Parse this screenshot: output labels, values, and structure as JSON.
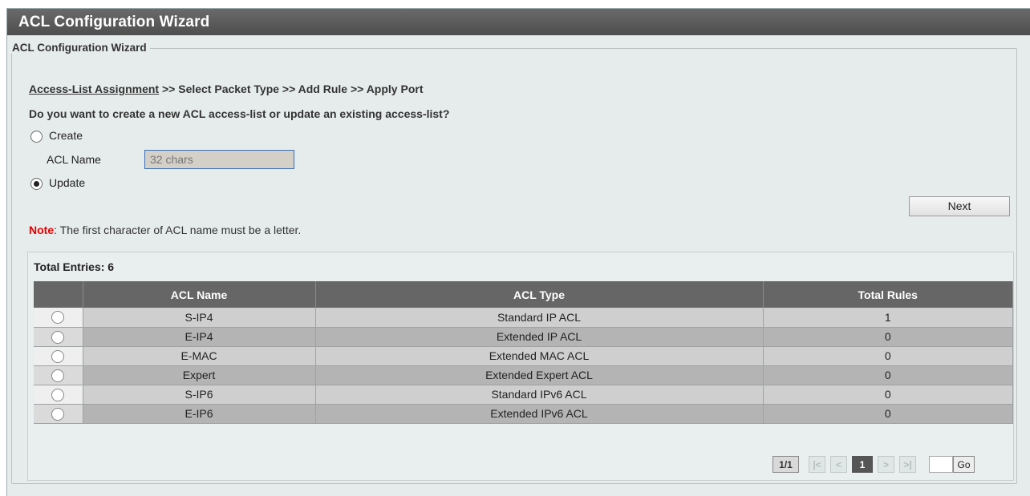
{
  "window": {
    "title": "ACL Configuration Wizard"
  },
  "panel": {
    "legend": "ACL Configuration Wizard"
  },
  "breadcrumb": {
    "current": "Access-List Assignment",
    "rest": " >> Select Packet Type >> Add Rule >> Apply Port"
  },
  "question": "Do you want to create a new ACL access-list or update an existing access-list?",
  "options": {
    "create_label": "Create",
    "update_label": "Update",
    "selected": "Update"
  },
  "acl_name": {
    "label": "ACL Name",
    "placeholder": "32 chars",
    "value": ""
  },
  "next_button": "Next",
  "note": {
    "prefix": "Note",
    "text": ":  The first character of ACL name must be a letter."
  },
  "table": {
    "total_label": "Total Entries: 6",
    "columns": [
      "",
      "ACL Name",
      "ACL Type",
      "Total Rules"
    ],
    "rows": [
      {
        "name": "S-IP4",
        "type": "Standard IP ACL",
        "rules": "1"
      },
      {
        "name": "E-IP4",
        "type": "Extended IP ACL",
        "rules": "0"
      },
      {
        "name": "E-MAC",
        "type": "Extended MAC ACL",
        "rules": "0"
      },
      {
        "name": "Expert",
        "type": "Extended Expert ACL",
        "rules": "0"
      },
      {
        "name": "S-IP6",
        "type": "Standard IPv6 ACL",
        "rules": "0"
      },
      {
        "name": "E-IP6",
        "type": "Extended IPv6 ACL",
        "rules": "0"
      }
    ]
  },
  "pagination": {
    "page_count": "1/1",
    "first": "|<",
    "prev": "<",
    "current": "1",
    "next": ">",
    "last": ">|",
    "go_label": "Go"
  }
}
